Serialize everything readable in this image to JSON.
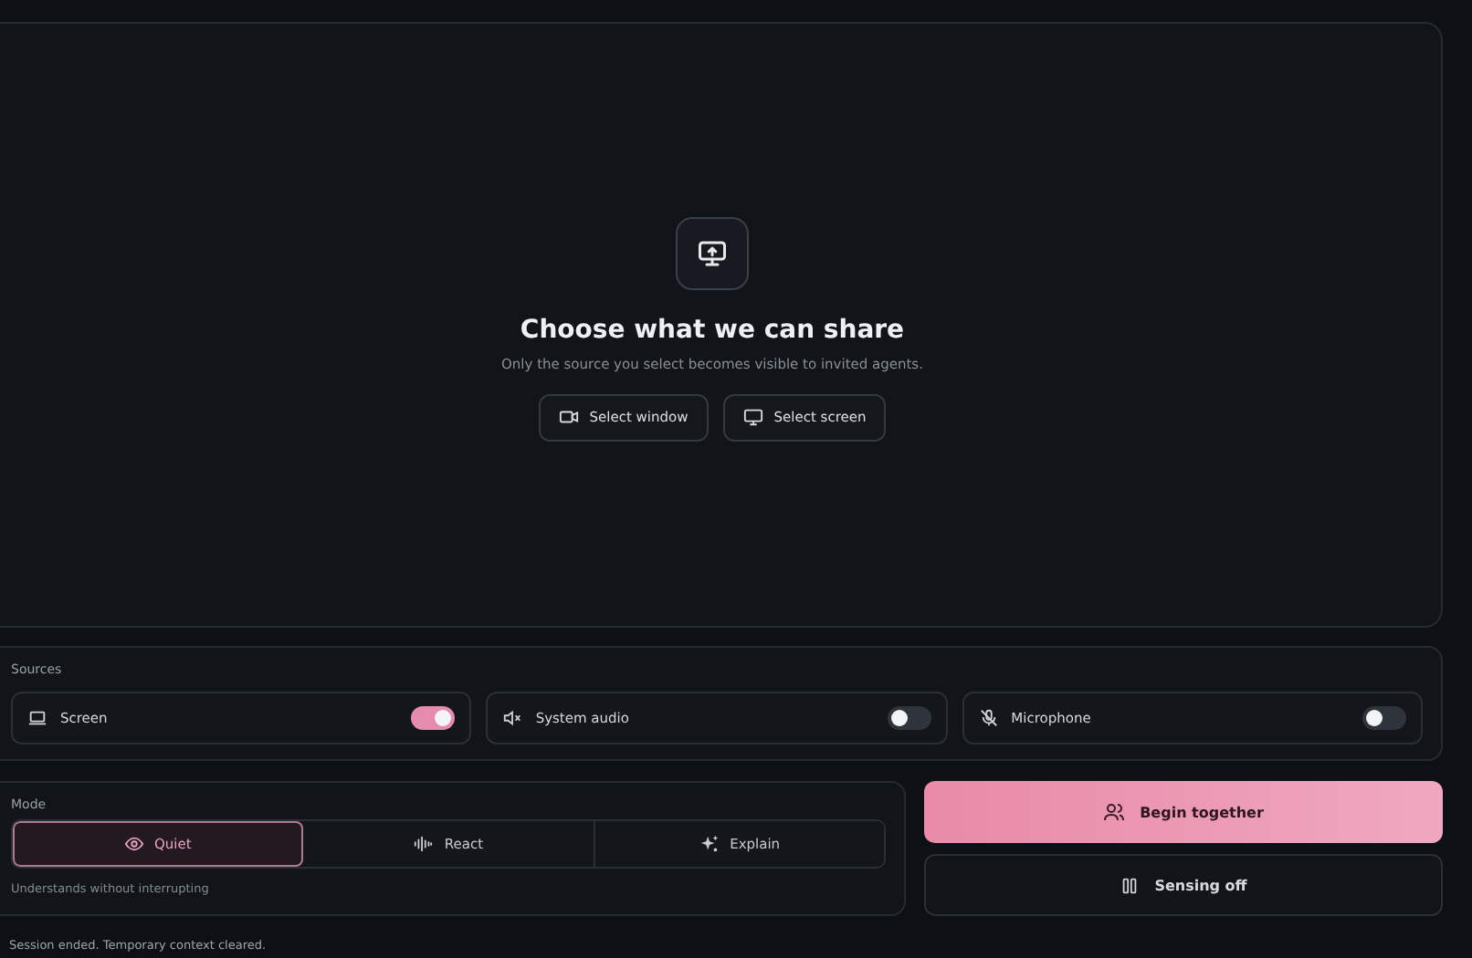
{
  "stage": {
    "title": "Choose what we can share",
    "subtitle": "Only the source you select becomes visible to invited agents.",
    "buttons": [
      "Select window",
      "Select screen"
    ]
  },
  "sources": {
    "label": "Sources",
    "items": [
      {
        "label": "Screen",
        "on": true
      },
      {
        "label": "System audio",
        "on": false
      },
      {
        "label": "Microphone",
        "on": false
      }
    ]
  },
  "mode": {
    "label": "Mode",
    "options": [
      {
        "label": "Quiet",
        "selected": true
      },
      {
        "label": "React",
        "selected": false
      },
      {
        "label": "Explain",
        "selected": false
      }
    ],
    "hint": "Understands without interrupting"
  },
  "actions": {
    "primary": "Begin together",
    "secondary": "Sensing off"
  },
  "status_bar": "Session ended. Temporary context cleared."
}
